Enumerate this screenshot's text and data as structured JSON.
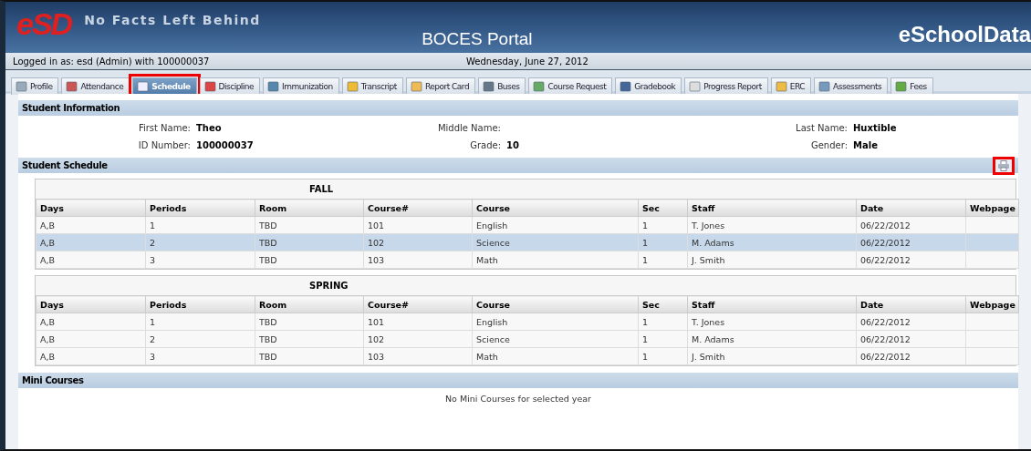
{
  "header": {
    "logo": "eSD",
    "tagline": "No Facts Left Behind",
    "title": "BOCES Portal",
    "brand": "eSchoolData"
  },
  "login_bar": {
    "user": "Logged in as: esd (Admin) with 100000037",
    "date": "Wednesday, June 27, 2012"
  },
  "tabs": [
    {
      "label": "Profile",
      "selected": false,
      "highlighted": false
    },
    {
      "label": "Attendance",
      "selected": false,
      "highlighted": false
    },
    {
      "label": "Schedule",
      "selected": true,
      "highlighted": true
    },
    {
      "label": "Discipline",
      "selected": false,
      "highlighted": false
    },
    {
      "label": "Immunization",
      "selected": false,
      "highlighted": false
    },
    {
      "label": "Transcript",
      "selected": false,
      "highlighted": false
    },
    {
      "label": "Report Card",
      "selected": false,
      "highlighted": false
    },
    {
      "label": "Buses",
      "selected": false,
      "highlighted": false
    },
    {
      "label": "Course Request",
      "selected": false,
      "highlighted": false
    },
    {
      "label": "Gradebook",
      "selected": false,
      "highlighted": false
    },
    {
      "label": "Progress Report",
      "selected": false,
      "highlighted": false
    },
    {
      "label": "ERC",
      "selected": false,
      "highlighted": false
    },
    {
      "label": "Assessments",
      "selected": false,
      "highlighted": false
    },
    {
      "label": "Fees",
      "selected": false,
      "highlighted": false
    }
  ],
  "student_information": {
    "title": "Student Information",
    "fields": [
      {
        "label": "First Name:",
        "value": "Theo"
      },
      {
        "label": "Middle Name:"
      },
      {
        "label": "Last Name:",
        "value": "Huxtible"
      },
      {
        "label": "ID Number:",
        "value": "100000037"
      },
      {
        "label": "Grade:",
        "value": "10"
      },
      {
        "label": "Gender:",
        "value": "Male"
      }
    ]
  },
  "student_schedule": {
    "title": "Student Schedule",
    "print_highlighted": true,
    "terms": [
      {
        "name": "FALL",
        "columns": [
          "Days",
          "Periods",
          "Room",
          "Course#",
          "Course",
          "Sec",
          "Staff",
          "Date",
          "Webpage"
        ],
        "rows": [
          {
            "selected": false,
            "cells": [
              "A,B",
              "1",
              "TBD",
              "101",
              "English",
              "1",
              "T. Jones",
              "06/22/2012",
              ""
            ]
          },
          {
            "selected": true,
            "cells": [
              "A,B",
              "2",
              "TBD",
              "102",
              "Science",
              "1",
              "M. Adams",
              "06/22/2012",
              ""
            ]
          },
          {
            "selected": false,
            "cells": [
              "A,B",
              "3",
              "TBD",
              "103",
              "Math",
              "1",
              "J. Smith",
              "06/22/2012",
              ""
            ]
          }
        ]
      },
      {
        "name": "SPRING",
        "columns": [
          "Days",
          "Periods",
          "Room",
          "Course#",
          "Course",
          "Sec",
          "Staff",
          "Date",
          "Webpage"
        ],
        "rows": [
          {
            "selected": false,
            "cells": [
              "A,B",
              "1",
              "TBD",
              "101",
              "English",
              "1",
              "T. Jones",
              "06/22/2012",
              ""
            ]
          },
          {
            "selected": false,
            "cells": [
              "A,B",
              "2",
              "TBD",
              "102",
              "Science",
              "1",
              "M. Adams",
              "06/22/2012",
              ""
            ]
          },
          {
            "selected": false,
            "cells": [
              "A,B",
              "3",
              "TBD",
              "103",
              "Math",
              "1",
              "J. Smith",
              "06/22/2012",
              ""
            ]
          }
        ]
      }
    ]
  },
  "mini_courses": {
    "title": "Mini Courses",
    "message": "No Mini Courses for selected year"
  }
}
